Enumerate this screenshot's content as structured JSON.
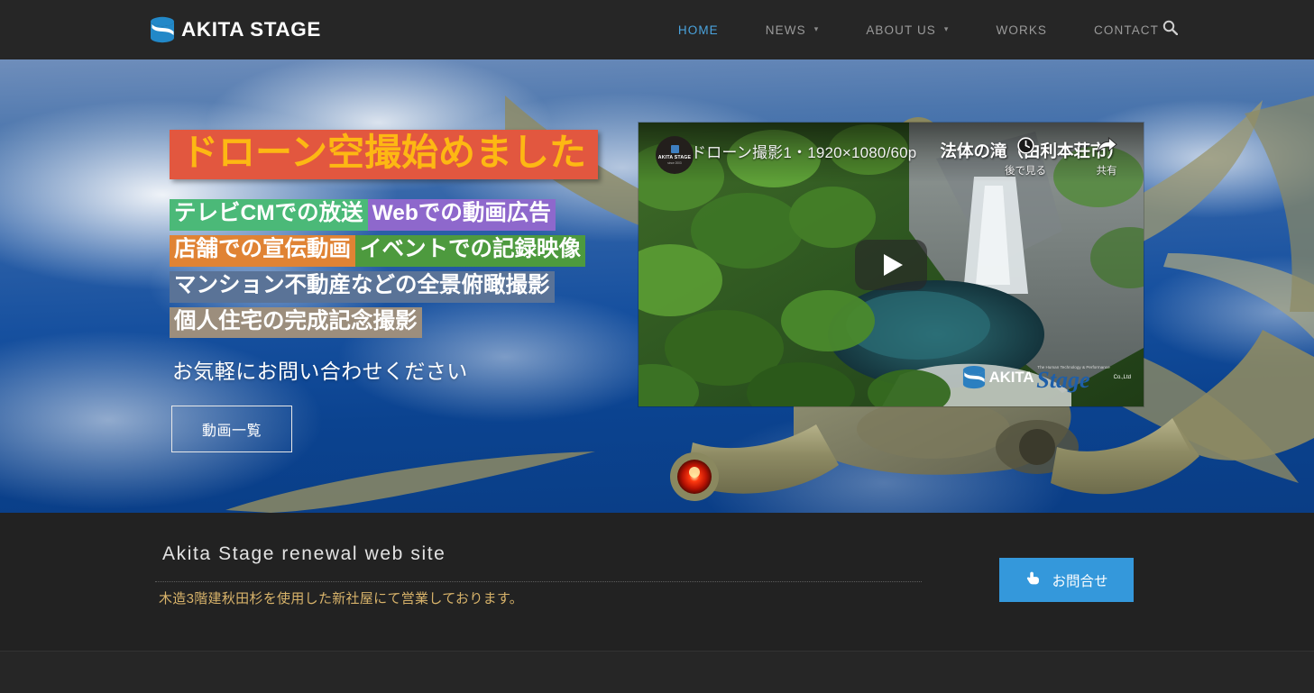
{
  "header": {
    "logo_text": "AKITA STAGE",
    "logo_icon": "akita-stage-logo-icon",
    "nav": [
      {
        "label": "HOME",
        "active": true,
        "has_caret": false
      },
      {
        "label": "NEWS",
        "active": false,
        "has_caret": true
      },
      {
        "label": "ABOUT US",
        "active": false,
        "has_caret": true
      },
      {
        "label": "WORKS",
        "active": false,
        "has_caret": false
      },
      {
        "label": "CONTACT",
        "active": false,
        "has_caret": false
      }
    ],
    "search_icon": "search-icon",
    "active_color": "#4aa3dd",
    "bg_color": "#262626"
  },
  "hero": {
    "title": "ドローン空撮始めました",
    "title_bg": "#e2573f",
    "title_color": "#fdb813",
    "lines": [
      [
        {
          "text": "テレビCMでの放送",
          "bg": "#4bb978"
        },
        {
          "text": "Webでの動画広告",
          "bg": "#8e68cc"
        }
      ],
      [
        {
          "text": "店舗での宣伝動画",
          "bg": "#e08334"
        },
        {
          "text": "イベントでの記録映像",
          "bg": "#4d9a3e"
        }
      ],
      [
        {
          "text": "マンション不動産などの全景俯瞰撮影",
          "bg": "#5a7397"
        }
      ],
      [
        {
          "text": "個人住宅の完成記念撮影",
          "bg": "#9c8e7d"
        }
      ]
    ],
    "lead": "お気軽にお問い合わせください",
    "button_label": "動画一覧"
  },
  "video": {
    "title": "ドローン撮影1・1920×1080/60p",
    "overlay_caption": "法体の滝（由利本荘市）",
    "channel_avatar_label": "AKITA STAGE",
    "channel_avatar_sub": "since 2003",
    "actions": [
      {
        "label": "後で見る",
        "icon": "clock-icon"
      },
      {
        "label": "共有",
        "icon": "share-arrow-icon"
      }
    ],
    "play_icon": "play-button-icon",
    "watermark": {
      "akita": "AKITA",
      "stage": "Stage",
      "tagline": "The Human Technology & Performance",
      "co": "Co.,Ltd"
    }
  },
  "section": {
    "title": "Akita Stage renewal web site",
    "body": "木造3階建秋田杉を使用した新社屋にて営業しております。",
    "body_color": "#d8b36a",
    "contact_button": {
      "label": "お問合せ",
      "icon": "pointing-hand-icon",
      "bg": "#3498db"
    }
  }
}
